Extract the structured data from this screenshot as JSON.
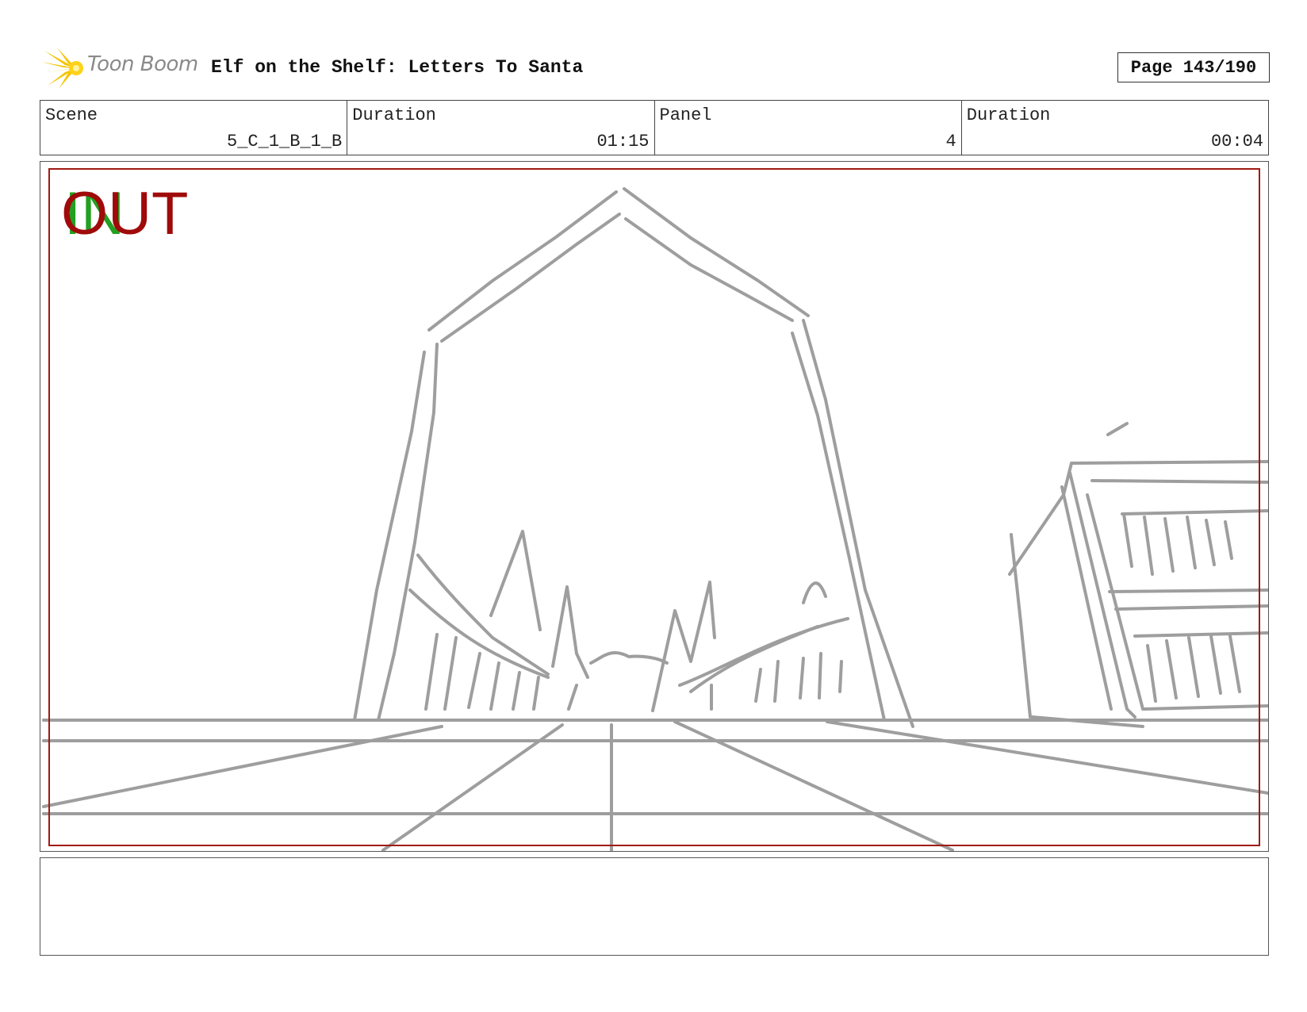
{
  "header": {
    "logo_text": "Toon Boom",
    "title": "Elf on the Shelf: Letters To Santa",
    "page": "Page 143/190"
  },
  "info": {
    "scene_label": "Scene",
    "scene_value": "5_C_1_B_1_B",
    "scene_duration_label": "Duration",
    "scene_duration_value": "01:15",
    "panel_label": "Panel",
    "panel_value": "4",
    "panel_duration_label": "Duration",
    "panel_duration_value": "00:04"
  },
  "panel": {
    "in_tag": "IN",
    "out_tag": "OUT",
    "sketch_color": "#9e9e9e",
    "in_color": "#22a022",
    "out_color": "#a00a0a",
    "safe_frame_color": "#a01b12"
  },
  "notes": {
    "text": ""
  }
}
